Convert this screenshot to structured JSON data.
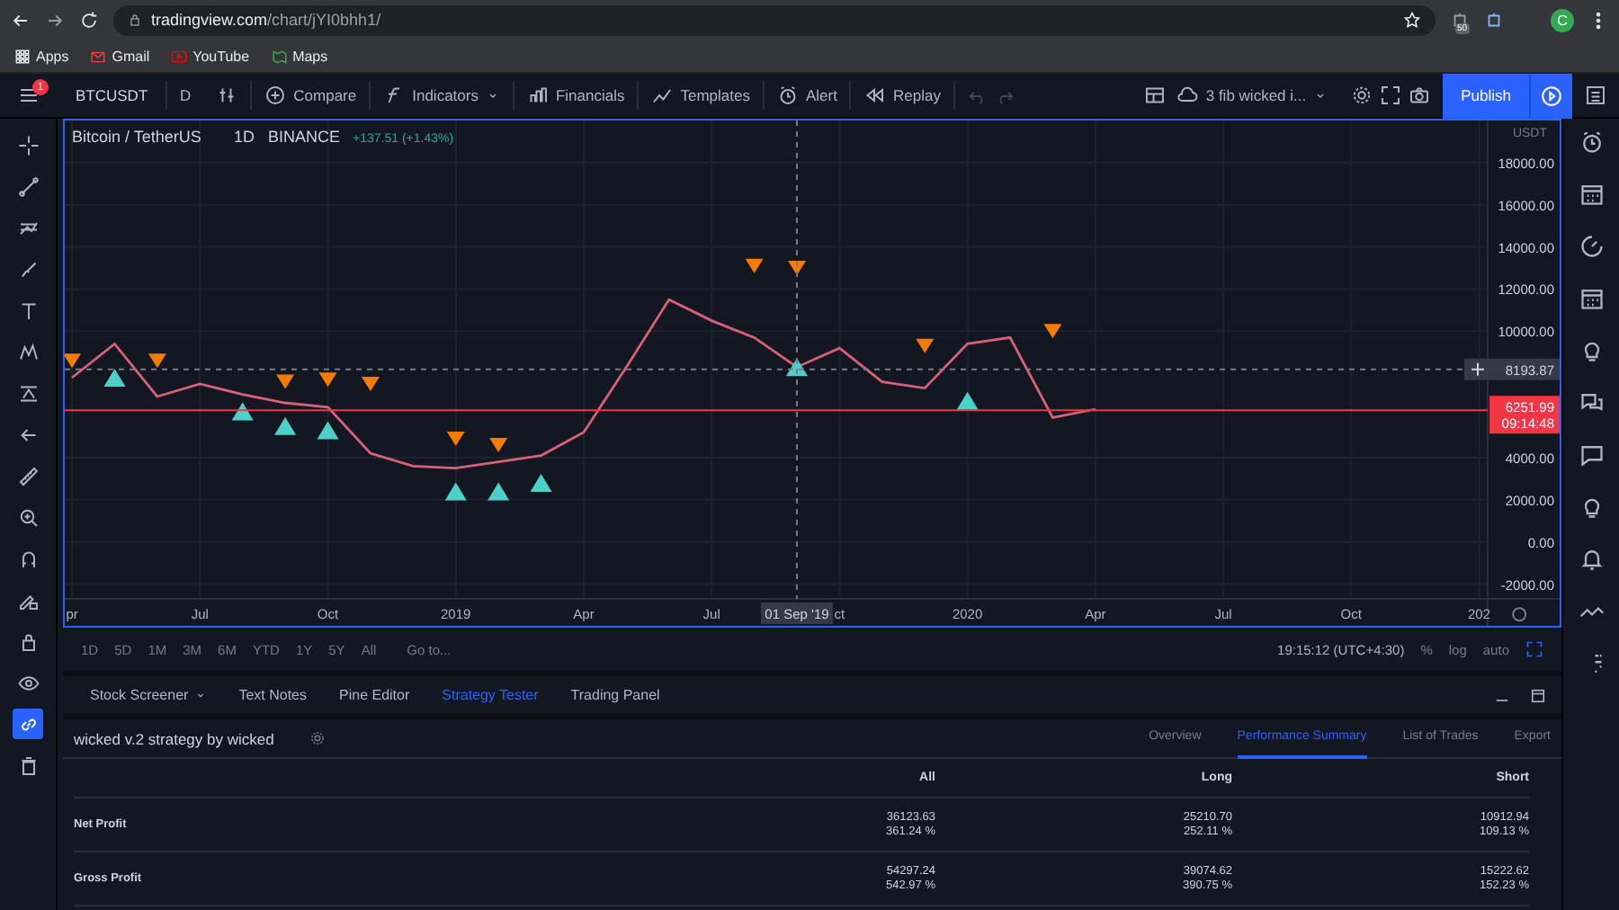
{
  "browser": {
    "url_host": "tradingview.com",
    "url_path": "/chart/jYI0bhh1/",
    "bookmarks": [
      {
        "kind": "apps",
        "label": "Apps"
      },
      {
        "kind": "gmail",
        "label": "Gmail"
      },
      {
        "kind": "youtube",
        "label": "YouTube"
      },
      {
        "kind": "maps",
        "label": "Maps"
      }
    ],
    "extension_badge": "50",
    "avatar": "C"
  },
  "toolbar": {
    "menu_badge": "1",
    "symbol": "BTCUSDT",
    "interval": "D",
    "buttons": [
      {
        "kind": "compare",
        "label": "Compare"
      },
      {
        "kind": "indicators",
        "label": "Indicators"
      },
      {
        "kind": "financials",
        "label": "Financials"
      },
      {
        "kind": "templates",
        "label": "Templates"
      },
      {
        "kind": "alert",
        "label": "Alert"
      },
      {
        "kind": "replay",
        "label": "Replay"
      }
    ],
    "layout_name": "3 fib wicked i...",
    "publish": "Publish"
  },
  "left_toolbar": [
    {
      "kind": "crosshair",
      "selected": false
    },
    {
      "kind": "trend-line",
      "selected": false
    },
    {
      "kind": "fib",
      "selected": false
    },
    {
      "kind": "brush",
      "selected": false
    },
    {
      "kind": "text",
      "selected": false
    },
    {
      "kind": "pattern",
      "selected": false
    },
    {
      "kind": "forecast",
      "selected": false
    },
    {
      "kind": "back",
      "selected": false
    },
    {
      "kind": "ruler",
      "selected": false
    },
    {
      "kind": "zoom",
      "selected": false
    },
    {
      "kind": "magnet",
      "selected": false
    },
    {
      "kind": "lock-pen",
      "selected": false
    },
    {
      "kind": "lock",
      "selected": false
    },
    {
      "kind": "eye",
      "selected": false
    },
    {
      "kind": "link",
      "selected": true
    },
    {
      "kind": "trash",
      "selected": false
    }
  ],
  "chart": {
    "legend": {
      "name": "Bitcoin / TetherUS",
      "interval": "1D",
      "exchange": "BINANCE",
      "change": "+137.51 (+1.43%)"
    },
    "price_unit": "USDT",
    "last_price": {
      "price": "6251.99",
      "countdown": "09:14:48"
    },
    "crosshair": {
      "price": "8193.87",
      "date": "01 Sep '19"
    },
    "chart_data": {
      "type": "line",
      "grid": true,
      "categories": [
        "pr",
        null,
        null,
        "Jul",
        null,
        null,
        "Oct",
        null,
        null,
        "2019",
        null,
        null,
        "Apr",
        null,
        null,
        "Jul",
        null,
        null,
        "ct",
        null,
        null,
        "2020",
        null,
        null,
        "Apr",
        null,
        null,
        "Jul",
        null,
        null,
        "Oct",
        null,
        null,
        "202"
      ],
      "series": [
        {
          "color": "#d9607a",
          "values": [
            7800,
            9400,
            6900,
            7500,
            7000,
            6600,
            6400,
            4200,
            3600,
            3500,
            3800,
            4100,
            5200,
            8300,
            11500,
            10500,
            9700,
            8300,
            9200,
            7600,
            7300,
            9400,
            9700,
            5900,
            6300,
            null,
            null,
            null,
            null,
            null,
            null,
            null,
            null,
            null
          ]
        },
        {
          "type": "scatter",
          "marker": "v",
          "color": "#f57c00",
          "values": [
            8600,
            null,
            8600,
            null,
            null,
            7600,
            7700,
            7500,
            null,
            4900,
            4600,
            null,
            null,
            null,
            null,
            null,
            13100,
            13000,
            null,
            null,
            9300,
            null,
            null,
            10000,
            null,
            null,
            null,
            null,
            null,
            null,
            null,
            null,
            null,
            null
          ]
        },
        {
          "type": "scatter",
          "marker": "^",
          "color": "#4dd0c7",
          "values": [
            null,
            7800,
            null,
            null,
            6200,
            5500,
            5300,
            null,
            null,
            2400,
            2400,
            2800,
            null,
            null,
            null,
            null,
            null,
            8300,
            null,
            null,
            null,
            6700,
            null,
            null,
            null,
            null,
            null,
            null,
            null,
            null,
            null,
            null,
            null,
            null
          ]
        }
      ],
      "ylim": [
        -2700,
        20000
      ],
      "yticks": [
        {
          "value": 18000,
          "label": "18000.00"
        },
        {
          "value": 16000,
          "label": "16000.00"
        },
        {
          "value": 14000,
          "label": "14000.00"
        },
        {
          "value": 12000,
          "label": "12000.00"
        },
        {
          "value": 10000,
          "label": "10000.00"
        },
        {
          "value": 4000,
          "label": "4000.00"
        },
        {
          "value": 2000,
          "label": "2000.00"
        },
        {
          "value": 0,
          "label": "0.00"
        },
        {
          "value": -2000,
          "label": "-2000.00"
        }
      ]
    }
  },
  "range_bar": {
    "ranges": [
      "1D",
      "5D",
      "1M",
      "3M",
      "6M",
      "YTD",
      "1Y",
      "5Y",
      "All"
    ],
    "goto": "Go to...",
    "clock": "19:15:12 (UTC+4:30)",
    "options": [
      "%",
      "log",
      "auto"
    ]
  },
  "panel_tabs": [
    {
      "label": "Stock Screener",
      "selected": false,
      "dropdown": true
    },
    {
      "label": "Text Notes",
      "selected": false,
      "dropdown": false
    },
    {
      "label": "Pine Editor",
      "selected": false,
      "dropdown": false
    },
    {
      "label": "Strategy Tester",
      "selected": true,
      "dropdown": false
    },
    {
      "label": "Trading Panel",
      "selected": false,
      "dropdown": false
    }
  ],
  "strategy": {
    "title": "wicked v.2 strategy by wicked",
    "tabs": [
      {
        "label": "Overview",
        "selected": false
      },
      {
        "label": "Performance Summary",
        "selected": true
      },
      {
        "label": "List of Trades",
        "selected": false
      },
      {
        "label": "Export",
        "selected": false
      }
    ],
    "columns": [
      "All",
      "Long",
      "Short"
    ],
    "rows": [
      {
        "label": "Net Profit",
        "values": [
          {
            "amount": "36123.63",
            "percent": "361.24 %"
          },
          {
            "amount": "25210.70",
            "percent": "252.11 %"
          },
          {
            "amount": "10912.94",
            "percent": "109.13 %"
          }
        ]
      },
      {
        "label": "Gross Profit",
        "values": [
          {
            "amount": "54297.24",
            "percent": "542.97 %"
          },
          {
            "amount": "39074.62",
            "percent": "390.75 %"
          },
          {
            "amount": "15222.62",
            "percent": "152.23 %"
          }
        ]
      }
    ]
  }
}
